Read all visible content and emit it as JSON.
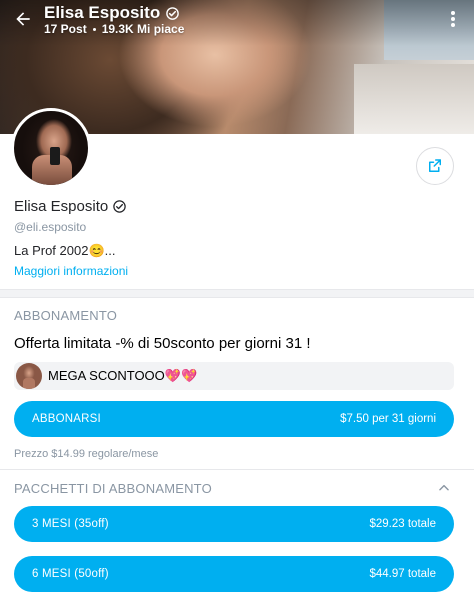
{
  "header": {
    "name": "Elisa Esposito",
    "posts": "17 Post",
    "likes": "19.3K Mi piace"
  },
  "profile": {
    "name": "Elisa Esposito",
    "handle": "@eli.esposito",
    "bio": "La Prof 2002😊...",
    "more_info_link": "Maggiori informazioni"
  },
  "subscription": {
    "section_title": "ABBONAMENTO",
    "offer_text": "Offerta limitata -% di 50sconto per giorni 31 !",
    "promo_message": "MEGA SCONTOOO💖💖",
    "subscribe_label": "ABBONARSI",
    "subscribe_price": "$7.50 per 31 giorni",
    "regular_price": "Prezzo $14.99 regolare/mese"
  },
  "bundles": {
    "section_title": "PACCHETTI DI ABBONAMENTO",
    "items": [
      {
        "label": "3 MESI (35off)",
        "price": "$29.23 totale"
      },
      {
        "label": "6 MESI (50off)",
        "price": "$44.97 totale"
      }
    ]
  },
  "icons": [
    "back-arrow-icon",
    "verified-icon",
    "more-vertical-icon",
    "share-icon",
    "chevron-up-icon"
  ],
  "colors": {
    "accent": "#00aff0",
    "muted": "#8a96a3",
    "text": "#242529"
  }
}
